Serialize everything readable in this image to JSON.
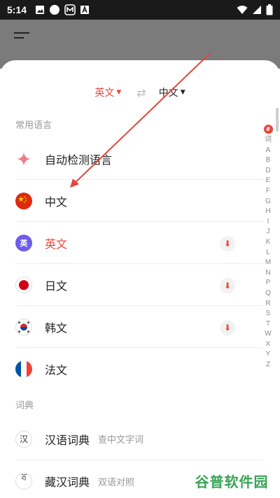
{
  "status": {
    "time": "5:14"
  },
  "lang_switch": {
    "source": "英文",
    "target": "中文"
  },
  "sections": {
    "common": "常用语言",
    "dict": "词典"
  },
  "languages": [
    {
      "label": "自动检测语言",
      "icon": "sparkle-icon"
    },
    {
      "label": "中文",
      "icon": "china-flag-icon"
    },
    {
      "label": "英文",
      "icon": "english-badge-icon",
      "badge": "英",
      "active": true,
      "downloadable": true
    },
    {
      "label": "日文",
      "icon": "japan-flag-icon",
      "downloadable": true
    },
    {
      "label": "韩文",
      "icon": "korea-flag-icon",
      "downloadable": true
    },
    {
      "label": "法文",
      "icon": "france-flag-icon"
    }
  ],
  "dictionaries": [
    {
      "label": "汉语词典",
      "sub": "查中文字词",
      "glyph": "汉"
    },
    {
      "label": "藏汉词典",
      "sub": "双语对照",
      "glyph": "བོ"
    }
  ],
  "index_bar": {
    "hash": "#",
    "letters": [
      "词",
      "A",
      "B",
      "D",
      "E",
      "F",
      "G",
      "H",
      "I",
      "J",
      "K",
      "L",
      "M",
      "N",
      "P",
      "Q",
      "R",
      "S",
      "T",
      "W",
      "X",
      "Y",
      "Z"
    ]
  },
  "watermark": "谷普软件园",
  "colors": {
    "accent": "#e8473a",
    "topbar": "#7b7b7b",
    "watermark": "#3aa356"
  }
}
